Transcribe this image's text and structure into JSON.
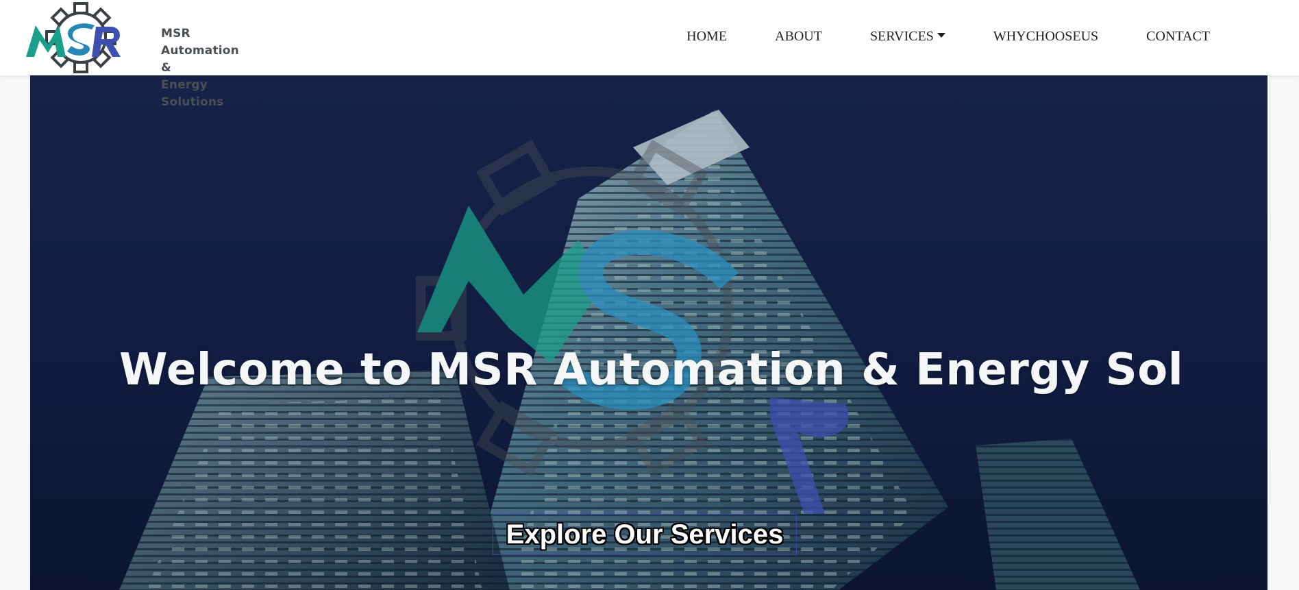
{
  "brand": {
    "logo_monogram": "MSR",
    "name_line1": "MSR Automation &",
    "name_line2": "Energy Solutions"
  },
  "nav": {
    "items": [
      {
        "label": "HOME"
      },
      {
        "label": "ABOUT"
      },
      {
        "label": "SERVICES",
        "has_dropdown": true
      },
      {
        "label": "WHYCHOOSEUS"
      },
      {
        "label": "CONTACT"
      }
    ]
  },
  "hero": {
    "title": "Welcome to MSR Automation & Energy Sol",
    "cta_label": "Explore Our Services",
    "watermark_monogram": "MSR"
  },
  "colors": {
    "brand_teal": "#1aa08a",
    "brand_blue": "#3d4fb0",
    "gear_gray": "#4a4e55",
    "hero_bg": "#0f1a3a",
    "nav_text": "#1f1f1f"
  },
  "icons": {
    "logo": "gear-monogram-logo-icon",
    "dropdown": "caret-down-icon"
  }
}
